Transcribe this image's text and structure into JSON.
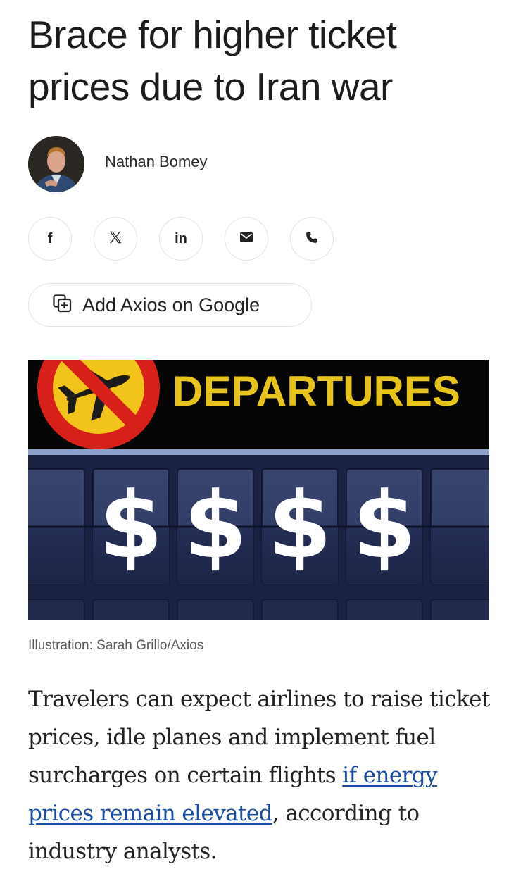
{
  "article": {
    "headline": "Brace for higher ticket prices due to Iran war",
    "author": {
      "name": "Nathan Bomey"
    },
    "share_buttons": [
      {
        "name": "facebook",
        "glyph": "f"
      },
      {
        "name": "x",
        "glyph": "𝕏"
      },
      {
        "name": "linkedin",
        "glyph": "in"
      },
      {
        "name": "email",
        "glyph": ""
      },
      {
        "name": "phone",
        "glyph": ""
      }
    ],
    "add_google_label": "Add Axios on Google",
    "hero": {
      "board_title": "DEPARTURES",
      "symbols": [
        "$",
        "$",
        "$",
        "$"
      ]
    },
    "caption": "Illustration: Sarah Grillo/Axios",
    "body": {
      "before_link": "Travelers can expect airlines to raise ticket prices, idle planes and implement fuel surcharges on certain flights ",
      "link_text": "if energy prices remain elevated",
      "after_link": ", according to industry analysts."
    }
  },
  "colors": {
    "link": "#1a4ca6",
    "board_title": "#e6c41c",
    "board_blue": "#2b3660",
    "no_sign_red": "#d8201b"
  }
}
